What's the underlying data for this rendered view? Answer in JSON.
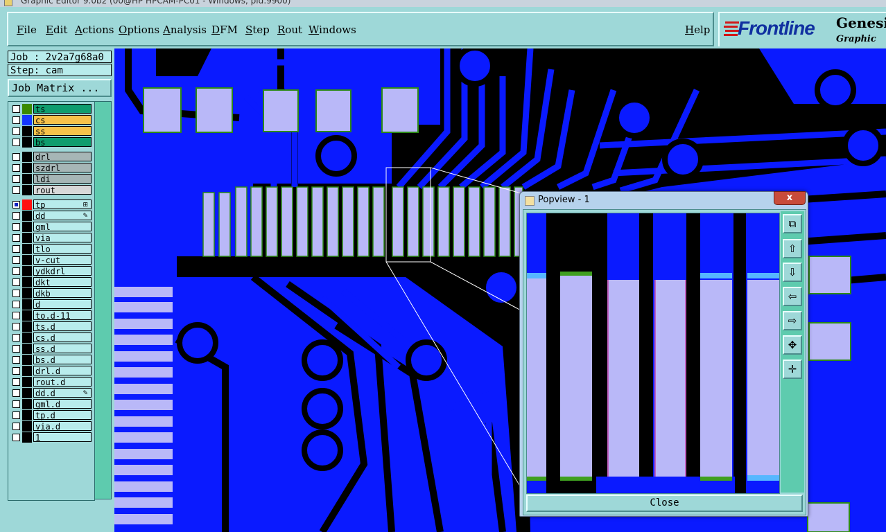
{
  "window": {
    "title": "Graphic Editor 9.0b2 (00@HP HPCAM-PC01 - Windows, pid:9900)"
  },
  "menu": {
    "items": [
      "File",
      "Edit",
      "Actions",
      "Options",
      "Analysis",
      "DFM",
      "Step",
      "Rout",
      "Windows"
    ],
    "help": "Help"
  },
  "logo": {
    "brand": "Frontline",
    "product": "Genesis",
    "subtitle": "Graphic"
  },
  "job": {
    "label": "Job : 2v2a7g68a0",
    "step": "Step: cam",
    "matrix_button": "Job Matrix ..."
  },
  "layers": [
    {
      "name": "ts",
      "bg": "#0f9d6e",
      "swatch": "#3a8a00",
      "mark": ""
    },
    {
      "name": "cs",
      "bg": "#f7c24a",
      "swatch": "#1436ff",
      "mark": ""
    },
    {
      "name": "ss",
      "bg": "#f7c24a",
      "swatch": "#000000",
      "mark": ""
    },
    {
      "name": "bs",
      "bg": "#0f9d6e",
      "swatch": "#000000",
      "mark": ""
    },
    {
      "name": "drl",
      "bg": "#a6b6b6",
      "swatch": "#000000",
      "mark": ""
    },
    {
      "name": "szdrl",
      "bg": "#a6b6b6",
      "swatch": "#000000",
      "mark": ""
    },
    {
      "name": "ldi",
      "bg": "#a6b6b6",
      "swatch": "#000000",
      "mark": ""
    },
    {
      "name": "rout",
      "bg": "#d8d8d8",
      "swatch": "#000000",
      "mark": ""
    },
    {
      "name": "tp",
      "bg": "#b8ecec",
      "swatch": "#ff1010",
      "mark": "⊞",
      "checked": true
    },
    {
      "name": "dd",
      "bg": "#b8ecec",
      "swatch": "#000000",
      "mark": "✎"
    },
    {
      "name": "gml",
      "bg": "#b8ecec",
      "swatch": "#000000",
      "mark": ""
    },
    {
      "name": "via",
      "bg": "#b8ecec",
      "swatch": "#000000",
      "mark": ""
    },
    {
      "name": "tlo",
      "bg": "#b8ecec",
      "swatch": "#000000",
      "mark": ""
    },
    {
      "name": "v-cut",
      "bg": "#b8ecec",
      "swatch": "#000000",
      "mark": ""
    },
    {
      "name": "ydkdrl",
      "bg": "#b8ecec",
      "swatch": "#000000",
      "mark": ""
    },
    {
      "name": "dkt",
      "bg": "#b8ecec",
      "swatch": "#000000",
      "mark": ""
    },
    {
      "name": "dkb",
      "bg": "#b8ecec",
      "swatch": "#000000",
      "mark": ""
    },
    {
      "name": "d",
      "bg": "#b8ecec",
      "swatch": "#000000",
      "mark": ""
    },
    {
      "name": "to.d-11",
      "bg": "#b8ecec",
      "swatch": "#000000",
      "mark": ""
    },
    {
      "name": "ts.d",
      "bg": "#b8ecec",
      "swatch": "#000000",
      "mark": ""
    },
    {
      "name": "cs.d",
      "bg": "#b8ecec",
      "swatch": "#000000",
      "mark": ""
    },
    {
      "name": "ss.d",
      "bg": "#b8ecec",
      "swatch": "#000000",
      "mark": ""
    },
    {
      "name": "bs.d",
      "bg": "#b8ecec",
      "swatch": "#000000",
      "mark": ""
    },
    {
      "name": "drl.d",
      "bg": "#b8ecec",
      "swatch": "#000000",
      "mark": ""
    },
    {
      "name": "rout.d",
      "bg": "#b8ecec",
      "swatch": "#000000",
      "mark": ""
    },
    {
      "name": "dd.d",
      "bg": "#b8ecec",
      "swatch": "#000000",
      "mark": "✎"
    },
    {
      "name": "gml.d",
      "bg": "#b8ecec",
      "swatch": "#000000",
      "mark": ""
    },
    {
      "name": "tp.d",
      "bg": "#b8ecec",
      "swatch": "#000000",
      "mark": ""
    },
    {
      "name": "via.d",
      "bg": "#b8ecec",
      "swatch": "#000000",
      "mark": ""
    },
    {
      "name": "1",
      "bg": "#b8ecec",
      "swatch": "#000000",
      "mark": ""
    }
  ],
  "popview": {
    "title": "Popview - 1",
    "close_label": "Close",
    "close_x": "x"
  },
  "colors": {
    "copper": "#0a1aff",
    "pad": "#b9b8f8",
    "background": "#000000",
    "panel": "#9ed8d8"
  }
}
